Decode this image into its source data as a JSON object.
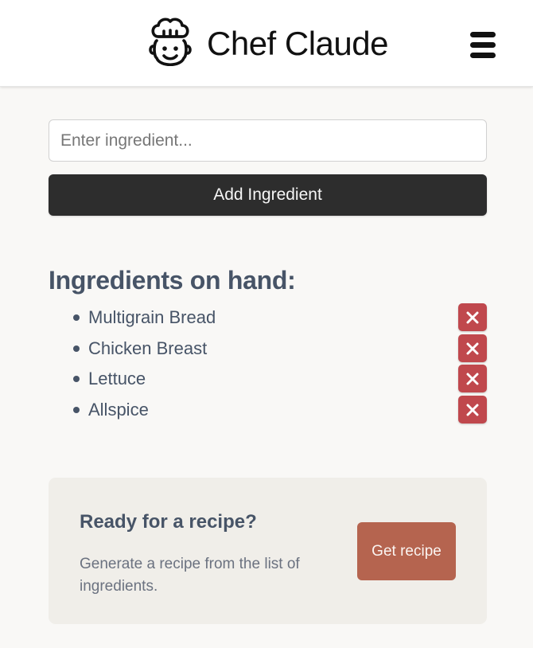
{
  "header": {
    "title": "Chef Claude",
    "logo_icon": "chef-face-icon",
    "menu_icon": "hamburger-menu-icon"
  },
  "form": {
    "input_placeholder": "Enter ingredient...",
    "input_value": "",
    "add_button_label": "Add Ingredient"
  },
  "ingredients": {
    "heading": "Ingredients on hand:",
    "remove_icon": "close-x-icon",
    "items": [
      {
        "label": "Multigrain Bread"
      },
      {
        "label": "Chicken Breast"
      },
      {
        "label": "Lettuce"
      },
      {
        "label": "Allspice"
      }
    ]
  },
  "cta": {
    "title": "Ready for a recipe?",
    "description": "Generate a recipe from the list of ingredients.",
    "button_label": "Get recipe"
  },
  "colors": {
    "page_bg": "#f9f8f6",
    "primary_button": "#2d2d2d",
    "remove_button": "#c0484d",
    "get_recipe_button": "#b5644f",
    "cta_bg": "#f0eee9",
    "text_slate": "#475467"
  }
}
